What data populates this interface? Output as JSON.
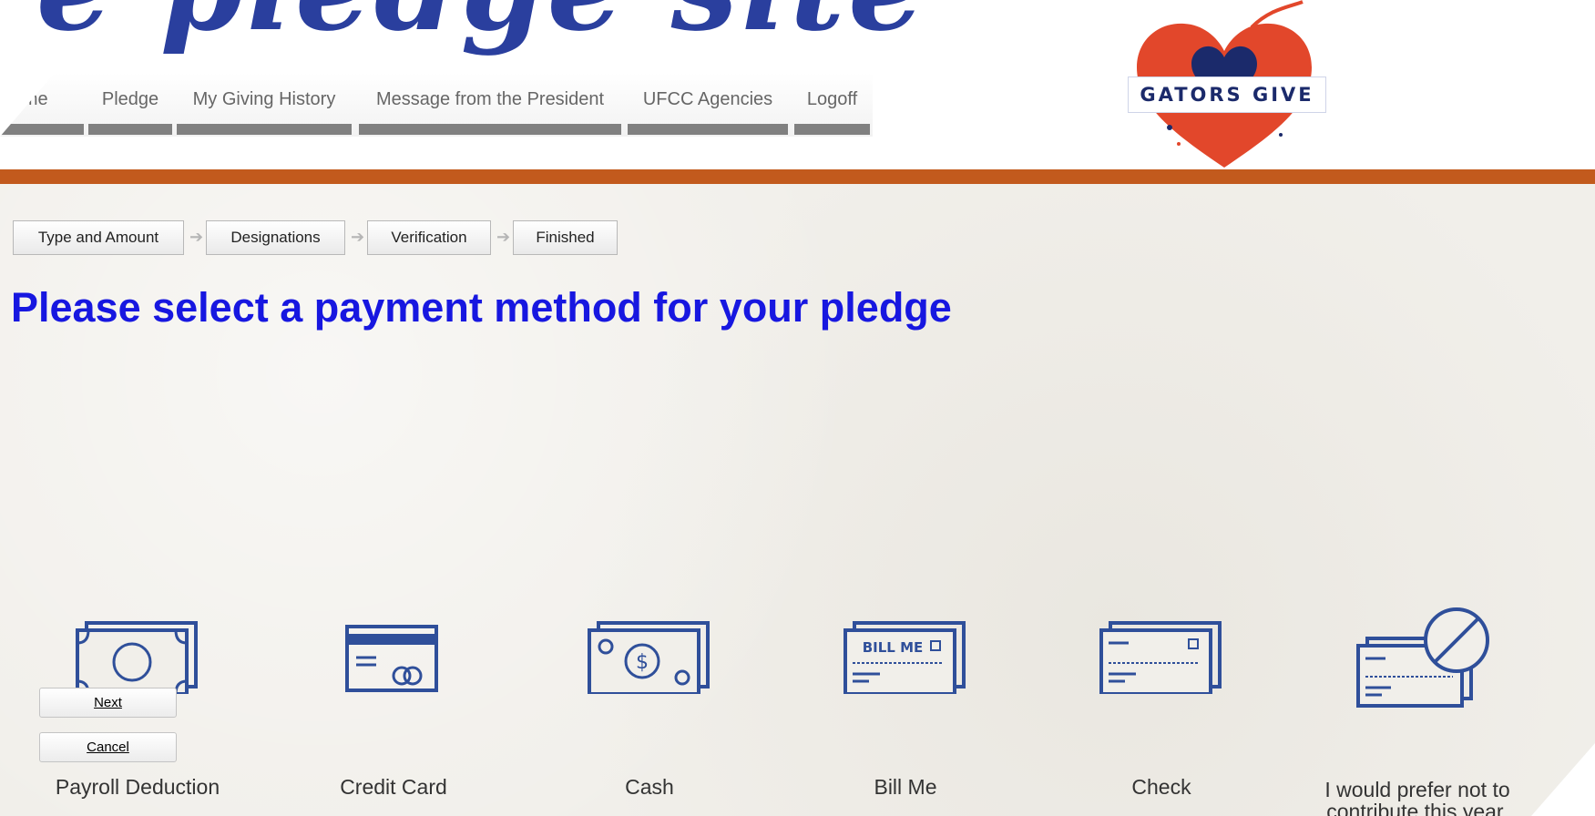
{
  "header": {
    "script_title": "e pledge site",
    "logo_text": "GATORS GIVE",
    "nav": [
      {
        "label": "Home"
      },
      {
        "label": "Pledge"
      },
      {
        "label": "My Giving History"
      },
      {
        "label": "Message from the President"
      },
      {
        "label": "UFCC Agencies"
      },
      {
        "label": "Logoff"
      }
    ]
  },
  "steps": [
    {
      "label": "Type and Amount"
    },
    {
      "label": "Designations"
    },
    {
      "label": "Verification"
    },
    {
      "label": "Finished"
    }
  ],
  "page_title": "Please select a payment method for your pledge",
  "payment_options": [
    {
      "label": "Payroll Deduction",
      "icon": "payroll-icon"
    },
    {
      "label": "Credit Card",
      "icon": "credit-card-icon"
    },
    {
      "label": "Cash",
      "icon": "cash-icon"
    },
    {
      "label": "Bill Me",
      "icon": "bill-me-icon",
      "icon_text": "BILL ME"
    },
    {
      "label": "Check",
      "icon": "check-icon"
    },
    {
      "label_line1": "I would prefer not to",
      "label_line2": "contribute this year.",
      "icon": "no-contribution-icon"
    }
  ],
  "buttons": {
    "next": "Next",
    "cancel": "Cancel"
  },
  "colors": {
    "accent_orange": "#c25a1d",
    "title_blue": "#1717e0",
    "icon_blue": "#2f4f9a",
    "brand_navy": "#1b2a6b",
    "heart_red": "#e2472b"
  }
}
